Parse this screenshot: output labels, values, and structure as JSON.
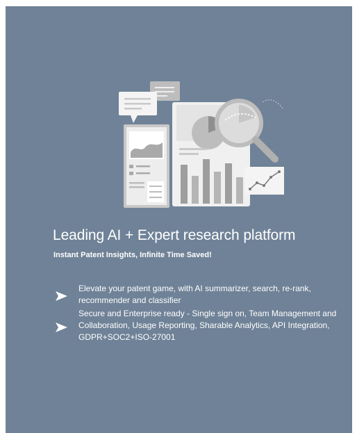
{
  "hero": {
    "title": "Leading AI + Expert research platform",
    "subtitle": "Instant Patent Insights, Infinite Time Saved!",
    "illustration_icon": "patent-analytics-illustration"
  },
  "features": [
    {
      "icon": "arrow-bullet-icon",
      "text": "Elevate your patent game, with AI summarizer, search, re-rank, recommender and classifier"
    },
    {
      "icon": "arrow-bullet-icon",
      "text": "Secure and Enterprise ready - Single sign on, Team Management and Collaboration, Usage Reporting, Sharable Analytics, API Integration, GDPR+SOC2+ISO-27001"
    }
  ],
  "colors": {
    "panel_background": "#6f8297",
    "text": "#ffffff",
    "illustration_light": "#f2f2f2",
    "illustration_mid": "#bfbfbf",
    "illustration_dark": "#a6a6a6"
  }
}
